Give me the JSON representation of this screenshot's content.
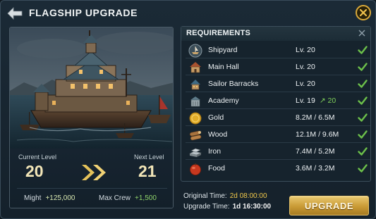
{
  "header": {
    "title": "FLAGSHIP UPGRADE",
    "back_icon": "back-arrow-icon",
    "close_icon": "close-icon"
  },
  "levels": {
    "current_label": "Current Level",
    "current_value": "20",
    "next_label": "Next Level",
    "next_value": "21"
  },
  "stats": {
    "might_label": "Might",
    "might_value": "+125,000",
    "crew_label": "Max Crew",
    "crew_value": "+1,500"
  },
  "requirements": {
    "title": "REQUIREMENTS",
    "items": [
      {
        "name": "Shipyard",
        "value": "Lv. 20",
        "icon": "shipyard-icon",
        "met": true
      },
      {
        "name": "Main Hall",
        "value": "Lv. 20",
        "icon": "main-hall-icon",
        "met": true
      },
      {
        "name": "Sailor Barracks",
        "value": "Lv. 20",
        "icon": "sailor-barracks-icon",
        "met": true
      },
      {
        "name": "Academy",
        "value": "Lv. 19",
        "extra": "↗ 20",
        "icon": "academy-icon",
        "met": true
      },
      {
        "name": "Gold",
        "value": "8.2M / 6.5M",
        "icon": "gold-icon",
        "met": true
      },
      {
        "name": "Wood",
        "value": "12.1M / 9.6M",
        "icon": "wood-icon",
        "met": true
      },
      {
        "name": "Iron",
        "value": "7.4M / 5.2M",
        "icon": "iron-icon",
        "met": true
      },
      {
        "name": "Food",
        "value": "3.6M / 3.2M",
        "icon": "food-icon",
        "met": true
      }
    ]
  },
  "times": {
    "original_label": "Original Time:",
    "original_value": "2d 08:00:00",
    "upgrade_label": "Upgrade Time:",
    "upgrade_value": "1d 16:30:00"
  },
  "upgrade_button": "UPGRADE",
  "colors": {
    "accent_gold": "#d9a93a",
    "check_green": "#6cc04a"
  }
}
